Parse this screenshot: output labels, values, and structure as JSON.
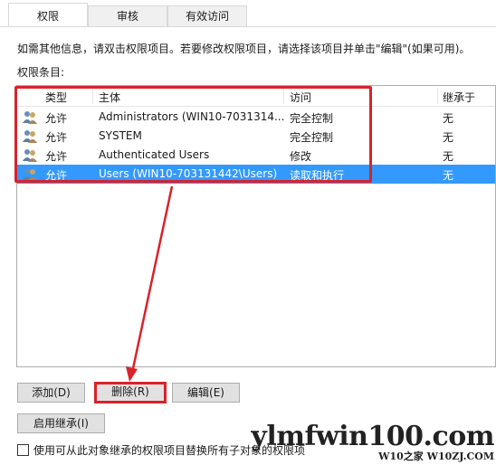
{
  "tabs": [
    {
      "label": "权限",
      "active": true
    },
    {
      "label": "审核",
      "active": false
    },
    {
      "label": "有效访问",
      "active": false
    }
  ],
  "info_text": "如需其他信息，请双击权限项目。若要修改权限项目，请选择该项目并单击\"编辑\"(如果可用)。",
  "entries_label": "权限条目:",
  "columns": [
    "类型",
    "主体",
    "访问",
    "继承于"
  ],
  "rows": [
    {
      "type": "允许",
      "principal": "Administrators (WIN10-7031314...",
      "access": "完全控制",
      "inherited": "无",
      "icon": "users-icon",
      "selected": false
    },
    {
      "type": "允许",
      "principal": "SYSTEM",
      "access": "完全控制",
      "inherited": "无",
      "icon": "users-icon",
      "selected": false
    },
    {
      "type": "允许",
      "principal": "Authenticated Users",
      "access": "修改",
      "inherited": "无",
      "icon": "users-icon",
      "selected": false
    },
    {
      "type": "允许",
      "principal": "Users (WIN10-703131442\\Users)",
      "access": "读取和执行",
      "inherited": "无",
      "icon": "users-icon",
      "selected": true
    }
  ],
  "buttons": {
    "add": "添加(D)",
    "remove": "删除(R)",
    "edit": "编辑(E)",
    "enable_inheritance": "启用继承(I)"
  },
  "replace_checkbox_label": "使用可从此对象继承的权限项目替换所有子对象的权限项",
  "watermark": {
    "main": "ylmfwin100.com",
    "sub": "W10之家 W10ZJ.COM"
  },
  "colors": {
    "selection": "#3399ff",
    "annotation_red": "#d9222b"
  }
}
